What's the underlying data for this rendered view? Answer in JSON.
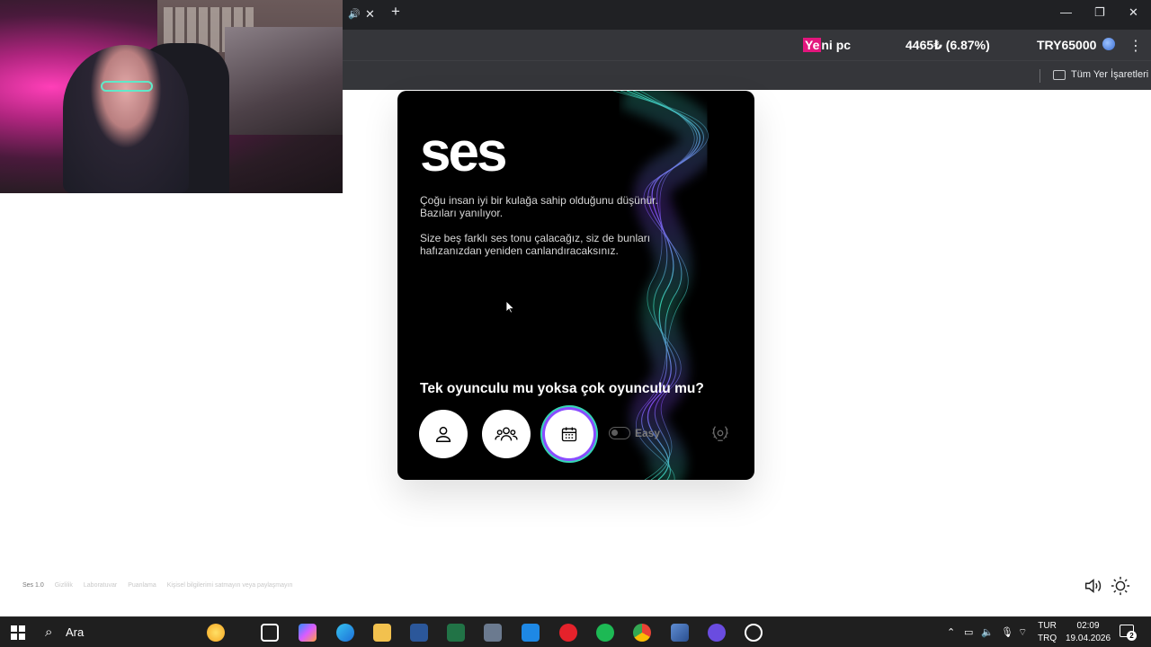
{
  "browser": {
    "tab_close_label": "✕",
    "new_tab_label": "+",
    "ticker": {
      "item1_highlight": "Ye",
      "item1_rest": "ni pc",
      "item2": "4465₺ (6.87%)",
      "item3": "TRY65000"
    },
    "bookmarks_label": "Tüm Yer İşaretleri"
  },
  "card": {
    "logo": "ses",
    "paragraph1": "Çoğu insan iyi bir kulağa sahip olduğunu düşünür. Bazıları yanılıyor.",
    "paragraph2": "Size beş farklı ses tonu çalacağız, siz de bunları hafızanızdan yeniden canlandıracaksınız.",
    "question": "Tek oyunculu mu yoksa çok oyunculu mu?",
    "difficulty_label": "Easy"
  },
  "footer": {
    "version": "Ses 1.0",
    "links": [
      "Gizlilik",
      "Laboratuvar",
      "Puanlama",
      "Kişisel bilgilerimi satmayın veya paylaşmayın"
    ]
  },
  "taskbar": {
    "search_label": "Ara",
    "lang_line1": "TUR",
    "lang_line2": "TRQ",
    "time": "02:09",
    "date": "19.04.2026",
    "notification_count": "2"
  },
  "colors": {
    "accent_pink": "#e3167d",
    "wave_green": "#37d7b4",
    "wave_purple": "#8a4cff"
  }
}
